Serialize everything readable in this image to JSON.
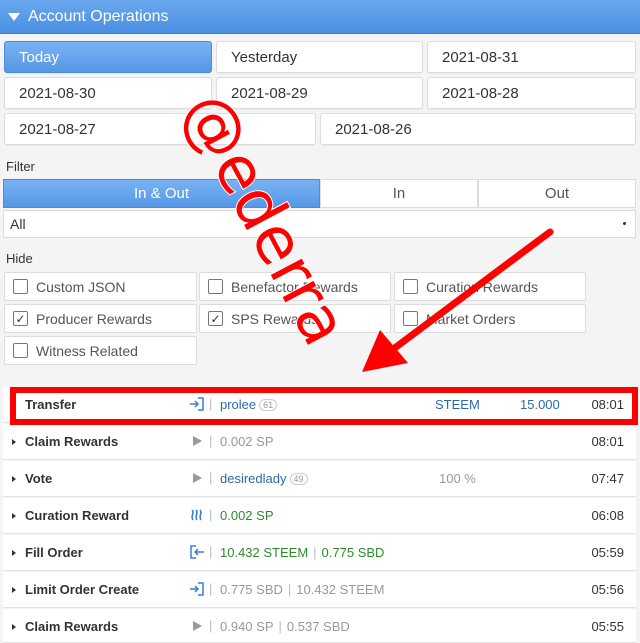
{
  "header": {
    "title": "Account Operations"
  },
  "dates": [
    {
      "label": "Today",
      "active": true
    },
    {
      "label": "Yesterday"
    },
    {
      "label": "2021-08-31"
    },
    {
      "label": "2021-08-30"
    },
    {
      "label": "2021-08-29"
    },
    {
      "label": "2021-08-28"
    },
    {
      "label": "2021-08-27"
    },
    {
      "label": "2021-08-26"
    }
  ],
  "filter": {
    "label": "Filter",
    "tabs": [
      "In & Out",
      "In",
      "Out"
    ],
    "select_value": "All"
  },
  "hide": {
    "label": "Hide",
    "options": [
      {
        "label": "Custom JSON",
        "checked": false
      },
      {
        "label": "Benefactor Rewards",
        "checked": false
      },
      {
        "label": "Curation Rewards",
        "checked": false
      },
      {
        "label": "Producer Rewards",
        "checked": true
      },
      {
        "label": "SPS Rewards",
        "checked": true
      },
      {
        "label": "Market Orders",
        "checked": false
      },
      {
        "label": "Witness Related",
        "checked": false
      }
    ]
  },
  "operations": [
    {
      "op": "Transfer",
      "user": "prolee",
      "rep": "61",
      "asset": "STEEM",
      "amount": "15.000",
      "time": "08:01"
    },
    {
      "op": "Claim Rewards",
      "detail": "0.002 SP",
      "time": "08:01"
    },
    {
      "op": "Vote",
      "user": "desiredlady",
      "rep": "49",
      "weight": "100 %",
      "time": "07:47"
    },
    {
      "op": "Curation Reward",
      "detail": "0.002 SP",
      "time": "06:08"
    },
    {
      "op": "Fill Order",
      "part1": "10.432 STEEM",
      "part2": "0.775 SBD",
      "time": "05:59"
    },
    {
      "op": "Limit Order Create",
      "part1": "0.775 SBD",
      "part2": "10.432 STEEM",
      "time": "05:56"
    },
    {
      "op": "Claim Rewards",
      "part1": "0.940 SP",
      "part2": "0.537 SBD",
      "time": "05:55"
    }
  ],
  "watermark": {
    "text": "@ederra"
  },
  "colors": {
    "accent": "#4a8fe2",
    "annotation": "#ff0000",
    "positive": "#2e8a2e",
    "link": "#2f68b0"
  }
}
